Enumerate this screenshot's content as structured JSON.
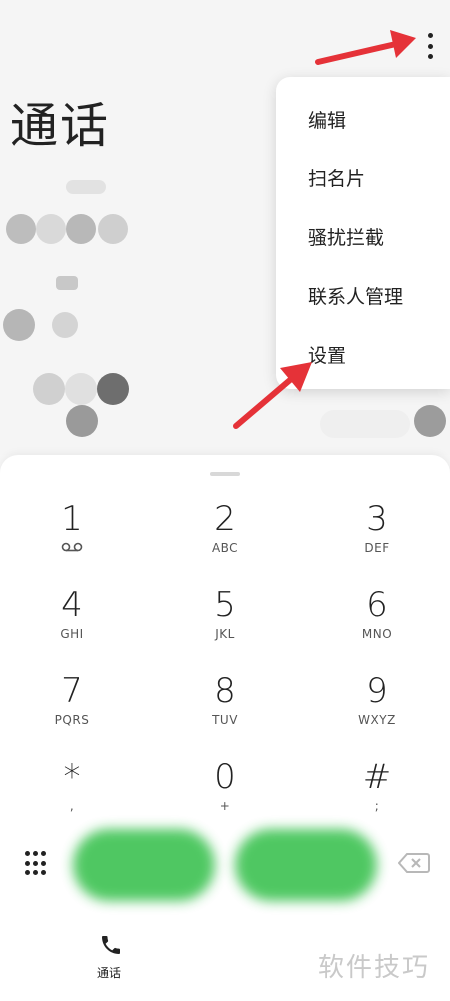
{
  "header": {
    "title": "通话"
  },
  "menu": {
    "items": [
      {
        "label": "编辑"
      },
      {
        "label": "扫名片"
      },
      {
        "label": "骚扰拦截"
      },
      {
        "label": "联系人管理"
      },
      {
        "label": "设置"
      }
    ]
  },
  "dialpad": {
    "keys": [
      {
        "digit": "1",
        "letters": ""
      },
      {
        "digit": "2",
        "letters": "ABC"
      },
      {
        "digit": "3",
        "letters": "DEF"
      },
      {
        "digit": "4",
        "letters": "GHI"
      },
      {
        "digit": "5",
        "letters": "JKL"
      },
      {
        "digit": "6",
        "letters": "MNO"
      },
      {
        "digit": "7",
        "letters": "PQRS"
      },
      {
        "digit": "8",
        "letters": "TUV"
      },
      {
        "digit": "9",
        "letters": "WXYZ"
      },
      {
        "digit": "*",
        "letters": ","
      },
      {
        "digit": "0",
        "letters": "+"
      },
      {
        "digit": "#",
        "letters": ";"
      }
    ]
  },
  "bottom_nav": {
    "calls_label": "通话"
  },
  "watermark": "软件技巧",
  "colors": {
    "call_green": "#46c55a",
    "annotation_red": "#e53238"
  }
}
